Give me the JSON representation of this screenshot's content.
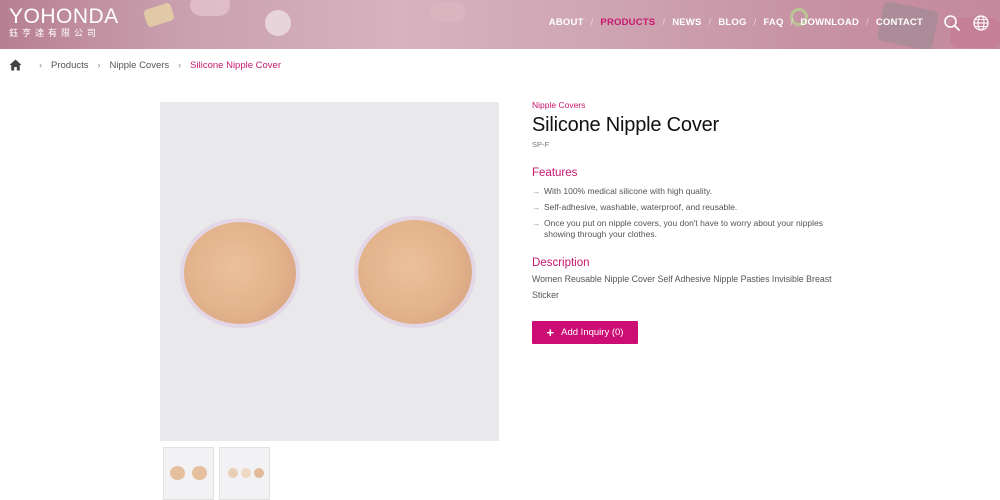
{
  "header": {
    "logo_text": "YOHONDA",
    "logo_subtext": "鈺亨達有限公司",
    "nav": [
      {
        "label": "ABOUT",
        "active": false
      },
      {
        "label": "PRODUCTS",
        "active": true
      },
      {
        "label": "NEWS",
        "active": false
      },
      {
        "label": "BLOG",
        "active": false
      },
      {
        "label": "FAQ",
        "active": false
      },
      {
        "label": "DOWNLOAD",
        "active": false
      },
      {
        "label": "CONTACT",
        "active": false
      }
    ],
    "icons": [
      "search-icon",
      "globe-icon"
    ]
  },
  "breadcrumb": {
    "home_icon": "home-icon",
    "items": [
      "Products",
      "Nipple Covers",
      "Silicone Nipple Cover"
    ]
  },
  "product": {
    "category": "Nipple Covers",
    "title": "Silicone Nipple Cover",
    "sku": "SP-F",
    "features_title": "Features",
    "features": [
      "With 100% medical silicone with high quality.",
      "Self-adhesive, washable, waterproof, and reusable.",
      "Once you put on nipple covers, you don't have to worry about your nipples showing through your clothes."
    ],
    "description_title": "Description",
    "description": "Women Reusable Nipple Cover Self Adhesive Nipple Pasties Invisible Breast Sticker",
    "inquiry_button": "Add Inquiry (0)"
  },
  "colors": {
    "accent": "#c8176f",
    "button": "#cc0e74",
    "header": "#c99aaa"
  }
}
